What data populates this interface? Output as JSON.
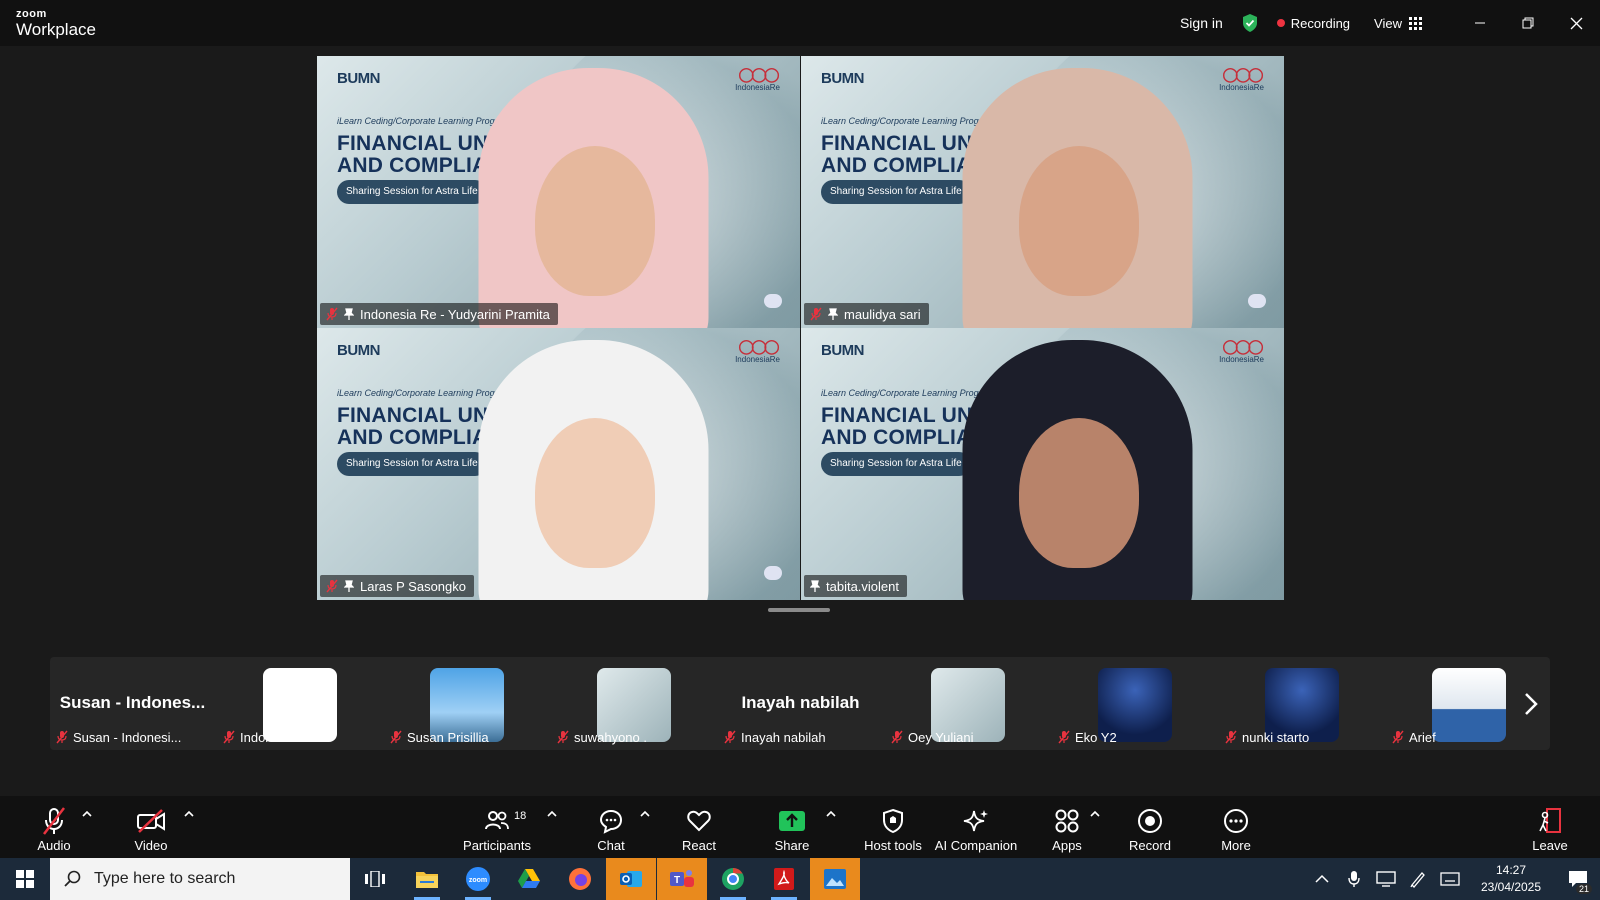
{
  "window": {
    "brand_top": "zoom",
    "brand_bottom": "Workplace",
    "sign_in": "Sign in",
    "recording": "Recording",
    "view": "View"
  },
  "tile_template": {
    "program": "iLearn Ceding/Corporate Learning Program",
    "headline_1": "FINANCIAL UNDERWRITING",
    "headline_2": "AND COMPLIANCE IN INDONESIA",
    "session": "Sharing Session for Astra Life",
    "bumn": "BUMN",
    "indonesia_re": "IndonesiaRe"
  },
  "tiles": [
    {
      "name": "Indonesia Re - Yudyarini Pramita",
      "muted": true,
      "active": false
    },
    {
      "name": "maulidya sari",
      "muted": true,
      "active": false
    },
    {
      "name": "Laras P Sasongko",
      "muted": true,
      "active": false
    },
    {
      "name": "tabita.violent",
      "muted": false,
      "active": true
    }
  ],
  "filmstrip": [
    {
      "name": "Susan - Indonesi...",
      "big_text": "Susan - Indones...",
      "kind": "text"
    },
    {
      "name": "Indonesia Re",
      "kind": "logo"
    },
    {
      "name": "Susan Prisillia",
      "kind": "city"
    },
    {
      "name": "suwahyono .",
      "kind": "slide"
    },
    {
      "name": "Inayah nabilah",
      "big_text": "Inayah nabilah",
      "kind": "text"
    },
    {
      "name": "Oey Yuliani",
      "kind": "slide"
    },
    {
      "name": "Eko Y2",
      "kind": "synergize"
    },
    {
      "name": "nunki starto",
      "kind": "synergize"
    },
    {
      "name": "Arief",
      "kind": "photo"
    }
  ],
  "toolbar": {
    "audio": "Audio",
    "video": "Video",
    "participants": "Participants",
    "participants_count": "18",
    "chat": "Chat",
    "react": "React",
    "share": "Share",
    "host_tools": "Host tools",
    "ai_companion": "AI Companion",
    "apps": "Apps",
    "record": "Record",
    "more": "More",
    "leave": "Leave"
  },
  "taskbar": {
    "search_placeholder": "Type here to search",
    "time": "14:27",
    "date": "23/04/2025",
    "notifications": "21"
  },
  "colors": {
    "active_speaker": "#2cd08a",
    "recording_dot": "#ee3340",
    "share_green": "#21c35a",
    "shield_green": "#2cb35a"
  }
}
